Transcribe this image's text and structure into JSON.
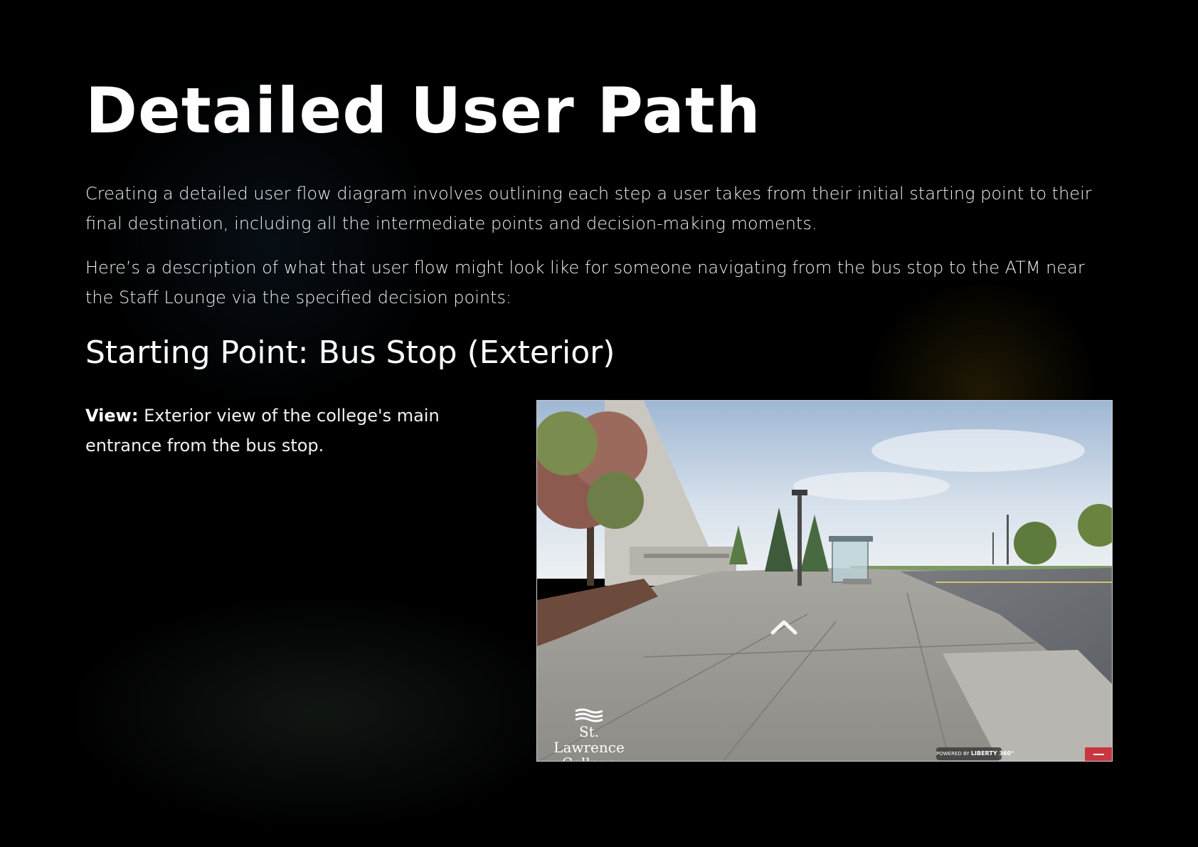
{
  "page": {
    "title": "Detailed User Path",
    "intro_paragraphs": [
      "Creating a detailed user flow diagram involves outlining each step a user takes from their initial starting point to their final destination, including all the intermediate points and decision-making moments.",
      "Here’s a description of what that user flow might look like for someone navigating from the bus stop to the ATM near the Staff Lounge via the specified decision points:"
    ]
  },
  "section": {
    "heading": "Starting Point: Bus Stop (Exterior)",
    "view_label": "View:",
    "view_text": " Exterior view of the college's main entrance from the bus stop."
  },
  "panorama": {
    "logo_line_1": "St. Lawrence",
    "logo_line_2": "College",
    "powered_prefix": "POWERED BY",
    "powered_brand": "LIBERTY 360°",
    "nav_arrow_icon": "chevron-up-icon",
    "minimize_icon": "minus-icon",
    "minimize_color": "#c8373f"
  },
  "colors": {
    "background": "#000000",
    "text": "#ffffff"
  }
}
